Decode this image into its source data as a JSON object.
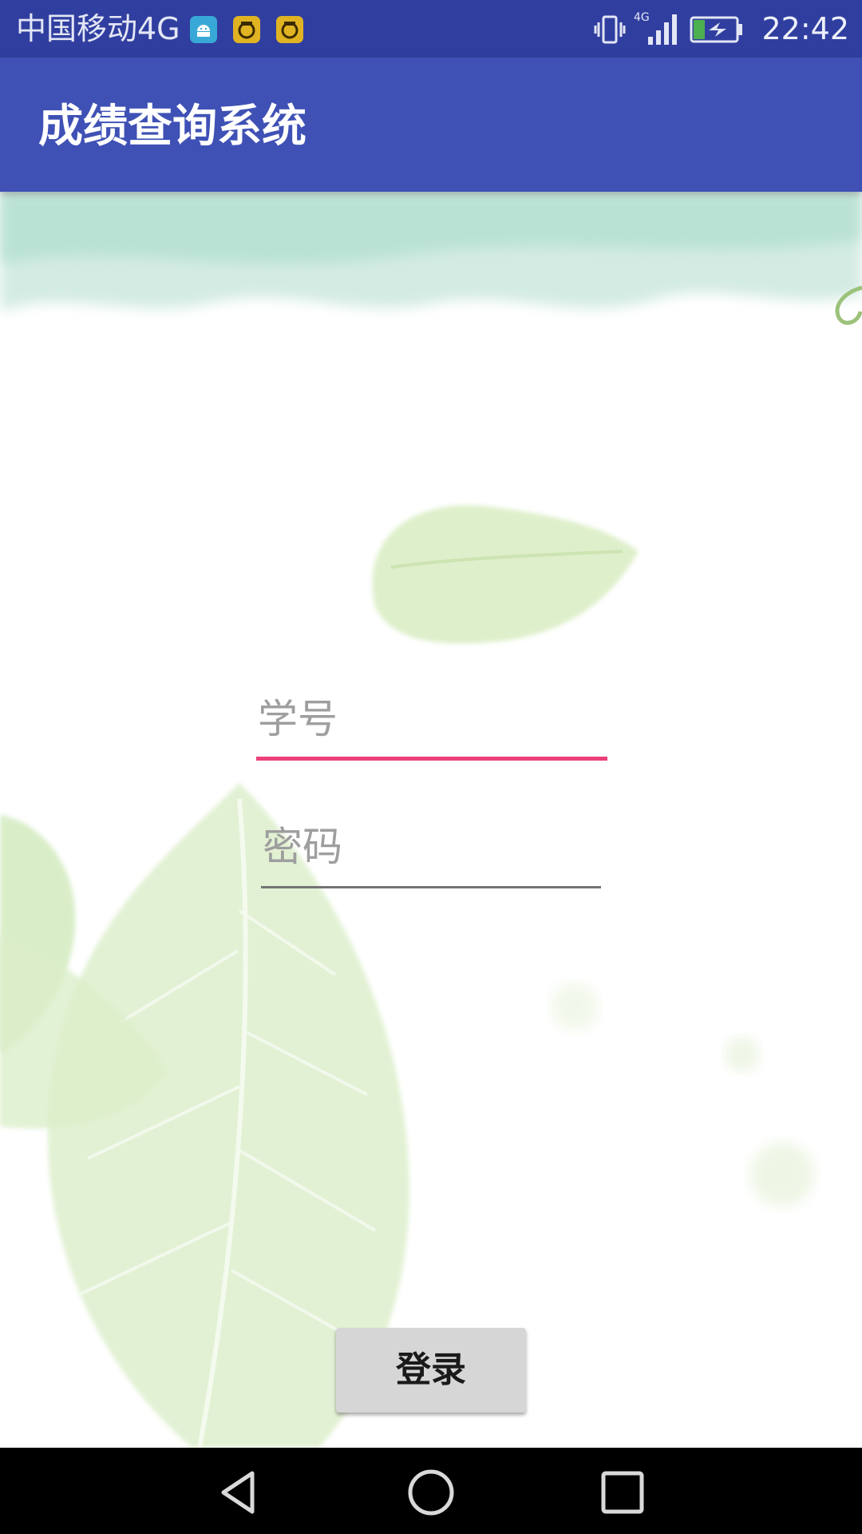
{
  "status_bar": {
    "carrier": "中国移动4G",
    "network_label": "4G",
    "time": "22:42",
    "icons": [
      "android-icon",
      "app-notification-icon",
      "app-notification-icon",
      "vibrate-icon",
      "signal-icon",
      "battery-charging-icon"
    ]
  },
  "app_bar": {
    "title": "成绩查询系统"
  },
  "form": {
    "student_id": {
      "placeholder": "学号",
      "value": ""
    },
    "password": {
      "placeholder": "密码",
      "value": ""
    },
    "login_label": "登录"
  },
  "nav_bar": {
    "icons": [
      "back-icon",
      "home-icon",
      "recent-apps-icon"
    ]
  },
  "colors": {
    "status_bar": "#303f9f",
    "app_bar": "#3f51b5",
    "accent_underline": "#ec407a",
    "button": "#d6d6d6"
  }
}
